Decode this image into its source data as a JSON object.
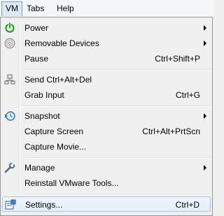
{
  "menubar": {
    "items": [
      "VM",
      "Tabs",
      "Help"
    ]
  },
  "menu": {
    "power": "Power",
    "removable": "Removable Devices",
    "pause": "Pause",
    "pause_sc": "Ctrl+Shift+P",
    "send_cad": "Send Ctrl+Alt+Del",
    "grab": "Grab Input",
    "grab_sc": "Ctrl+G",
    "snapshot": "Snapshot",
    "capture_screen": "Capture Screen",
    "capture_screen_sc": "Ctrl+Alt+PrtScn",
    "capture_movie": "Capture Movie...",
    "manage": "Manage",
    "reinstall": "Reinstall VMware Tools...",
    "settings": "Settings...",
    "settings_sc": "Ctrl+D"
  },
  "icons": {
    "power": "power-icon",
    "removable": "disc-icon",
    "send_cad": "network-computer-icon",
    "snapshot": "snapshot-clock-icon",
    "manage": "wrench-icon",
    "settings": "settings-icon"
  }
}
